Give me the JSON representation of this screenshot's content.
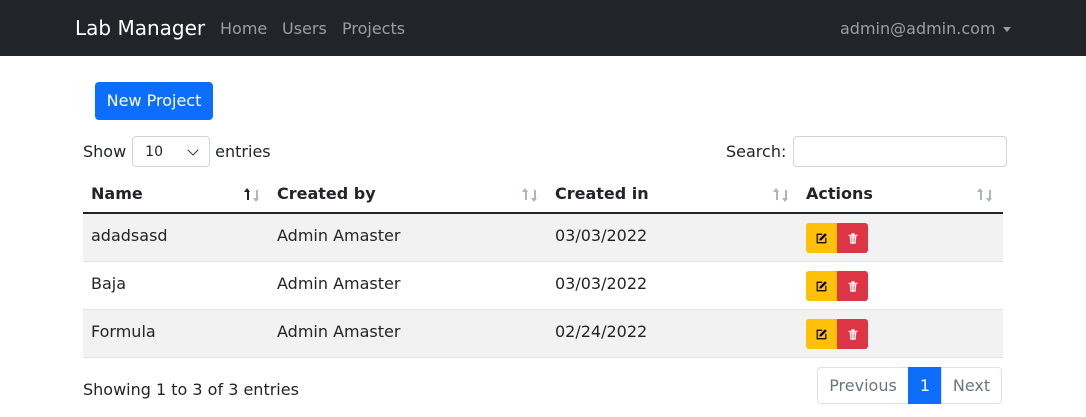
{
  "navbar": {
    "brand": "Lab Manager",
    "links": [
      "Home",
      "Users",
      "Projects"
    ],
    "user": "admin@admin.com"
  },
  "toolbar": {
    "new_project_label": "New Project"
  },
  "length": {
    "show_label": "Show",
    "value": "10",
    "entries_label": "entries"
  },
  "search": {
    "label": "Search:",
    "value": "",
    "placeholder": ""
  },
  "table": {
    "columns": [
      "Name",
      "Created by",
      "Created in",
      "Actions"
    ],
    "sorted_column": "Name",
    "sort_direction": "ascending",
    "rows": [
      {
        "name": "adadsasd",
        "created_by": "Admin Amaster",
        "created_in": "03/03/2022"
      },
      {
        "name": "Baja",
        "created_by": "Admin Amaster",
        "created_in": "03/03/2022"
      },
      {
        "name": "Formula",
        "created_by": "Admin Amaster",
        "created_in": "02/24/2022"
      }
    ]
  },
  "footer": {
    "info": "Showing 1 to 3 of 3 entries",
    "pagination": {
      "previous": "Previous",
      "current": "1",
      "next": "Next"
    }
  },
  "icons": {
    "edit": "edit-icon",
    "delete": "trash-icon",
    "user_menu": "caret-down-icon",
    "select": "chevron-down-icon",
    "sort": "sort-arrows-icon"
  },
  "colors": {
    "navbar": "#212529",
    "primary": "#0d6efd",
    "warning": "#ffc107",
    "danger": "#dc3545",
    "stripe": "#f2f2f2"
  }
}
